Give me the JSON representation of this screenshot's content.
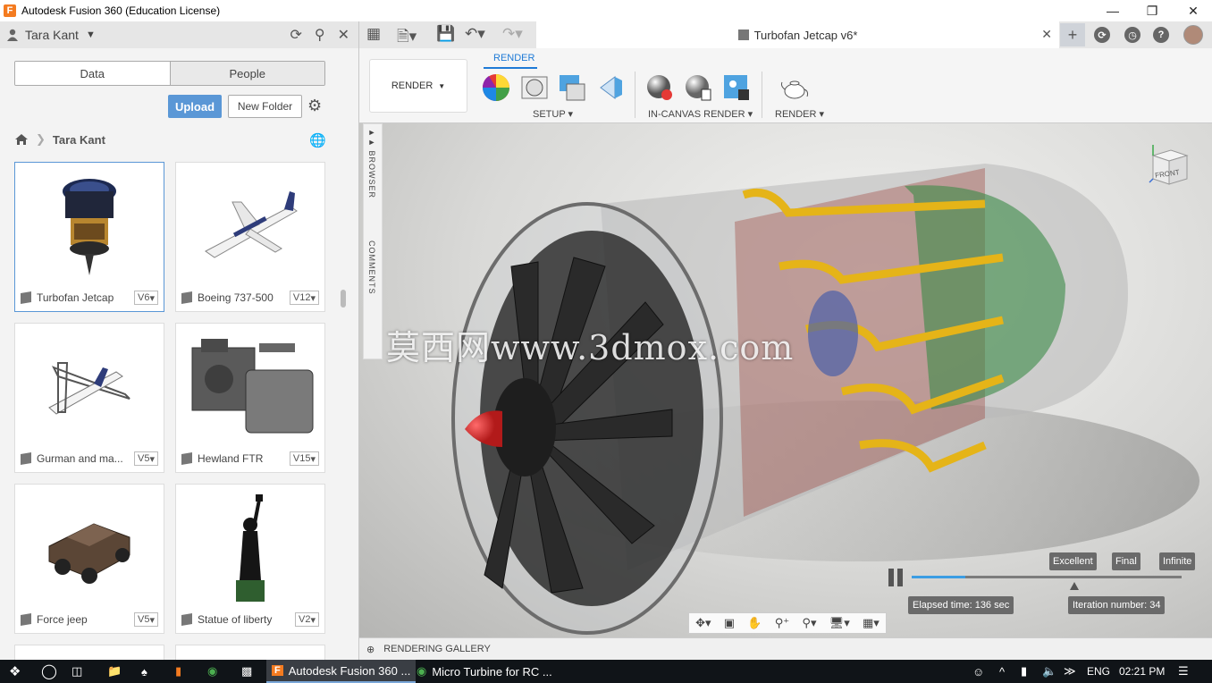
{
  "window": {
    "title": "Autodesk Fusion 360 (Education License)",
    "app_icon_letter": "F"
  },
  "data_panel": {
    "user": "Tara Kant",
    "tabs": [
      "Data",
      "People"
    ],
    "upload_label": "Upload",
    "new_folder_label": "New Folder",
    "breadcrumb": "Tara Kant",
    "items": [
      {
        "name": "Turbofan Jetcap",
        "version": "V6"
      },
      {
        "name": "Boeing 737-500",
        "version": "V12"
      },
      {
        "name": "Gurman and ma...",
        "version": "V5"
      },
      {
        "name": "Hewland FTR",
        "version": "V15"
      },
      {
        "name": "Force jeep",
        "version": "V5"
      },
      {
        "name": "Statue of liberty",
        "version": "V2"
      }
    ]
  },
  "doc_tab": {
    "title": "Turbofan Jetcap v6*"
  },
  "toolbar": {
    "workspace": "RENDER",
    "active_tab": "RENDER",
    "groups": {
      "setup": "SETUP",
      "in_canvas": "IN-CANVAS RENDER",
      "render": "RENDER"
    }
  },
  "viewport": {
    "side_tabs": [
      "BROWSER",
      "COMMENTS"
    ],
    "watermark": "莫西网www.3dmox.com",
    "viewcube_label": "FRONT",
    "quality": [
      "Excellent",
      "Final",
      "Infinite"
    ],
    "elapsed": "Elapsed time: 136 sec",
    "iteration": "Iteration number: 34",
    "progress": 0.2
  },
  "gallery_label": "RENDERING GALLERY",
  "taskbar": {
    "apps": [
      "Autodesk Fusion 360 ...",
      "Micro Turbine for RC ..."
    ],
    "language": "ENG",
    "time": "02:21 PM"
  },
  "colors": {
    "accent": "#1e7ad6",
    "upload": "#5a97d6",
    "taskbar": "#101418"
  }
}
